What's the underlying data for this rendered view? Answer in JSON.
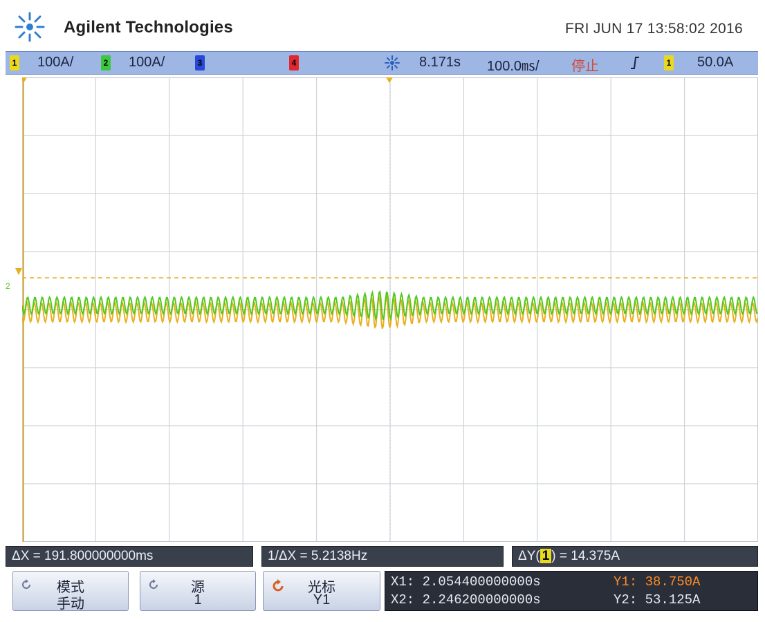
{
  "header": {
    "brand": "Agilent Technologies",
    "datetime": "FRI JUN 17 13:58:02 2016"
  },
  "statusbar": {
    "ch1": {
      "number": "1",
      "scale": "100A/"
    },
    "ch2": {
      "number": "2",
      "scale": "100A/"
    },
    "ch3": {
      "number": "3"
    },
    "ch4": {
      "number": "4"
    },
    "time_position": "8.171s",
    "time_scale": "100.0㎳/",
    "run_state": "停止",
    "trigger_source": "1",
    "trigger_level": "50.0A"
  },
  "measurements": {
    "delta_x": "ΔX = 191.800000000ms",
    "inv_delta_x": "1/ΔX = 5.2138Hz",
    "delta_y_prefix": "ΔY(",
    "delta_y_channel": "1",
    "delta_y_suffix": ") = 14.375A"
  },
  "softkeys": {
    "mode": {
      "label": "模式",
      "value": "手动"
    },
    "source": {
      "label": "源",
      "value": "1"
    },
    "cursor": {
      "label": "光标",
      "value": "Y1"
    }
  },
  "cursors": {
    "x1": "X1: 2.054400000000s",
    "x2": "X2: 2.246200000000s",
    "y1": "Y1: 38.750A",
    "y2": "Y2: 53.125A"
  },
  "colors": {
    "ch1_yellow": "#e8b020",
    "ch2_green": "#52c81c",
    "statusbar_blue": "#9eb6e4",
    "grid": "#cfd3d8",
    "cursor_active": "#ff8a28"
  }
}
